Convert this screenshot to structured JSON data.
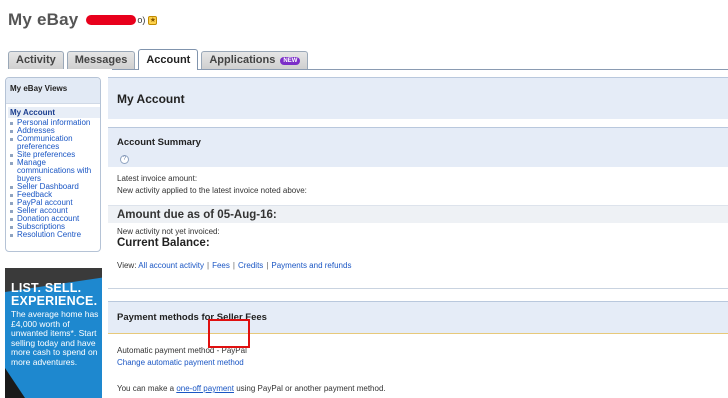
{
  "header": {
    "title": "My eBay",
    "user_suffix": "o)",
    "star_glyph": "★"
  },
  "tabs": [
    {
      "label": "Activity"
    },
    {
      "label": "Messages"
    },
    {
      "label": "Account"
    },
    {
      "label": "Applications",
      "badge": "NEW"
    }
  ],
  "sidebar": {
    "heading": "My eBay Views",
    "group": "My Account",
    "items": [
      "Personal information",
      "Addresses",
      "Communication preferences",
      "Site preferences",
      "Manage communications with buyers",
      "Seller Dashboard",
      "Feedback",
      "PayPal account",
      "Seller account",
      "Donation account",
      "Subscriptions",
      "Resolution Centre"
    ]
  },
  "ad": {
    "headline_1": "LIST. SELL.",
    "headline_2": "EXPERIENCE.",
    "body": "The average home has £4,000 worth of unwanted items*. Start selling today and have more cash to spend on more adventures."
  },
  "main": {
    "title": "My Account",
    "summary_title": "Account Summary",
    "help_glyph": "?",
    "latest_invoice": "Latest invoice amount:",
    "new_activity_applied": "New activity applied to the latest invoice noted above:",
    "amount_due": "Amount due as of 05-Aug-16:",
    "not_invoiced": "New activity not yet invoiced:",
    "current_balance": "Current Balance:",
    "view_label": "View:",
    "view_links": [
      "All account activity",
      "Fees",
      "Credits",
      "Payments and refunds"
    ],
    "payment_title": "Payment methods for Seller Fees",
    "auto_method_label": "Automatic payment method",
    "auto_method_value": " - PayPal",
    "change_link": "Change automatic payment method",
    "oneoff_prefix": "You can make a ",
    "oneoff_link": "one-off payment",
    "oneoff_suffix": " using PayPal or another payment method."
  },
  "colors": {
    "panel_header_bg": "#e5ecf7",
    "link": "#1a56c4",
    "highlight_box": "#e01010",
    "ad_bg": "#1e88cf"
  }
}
